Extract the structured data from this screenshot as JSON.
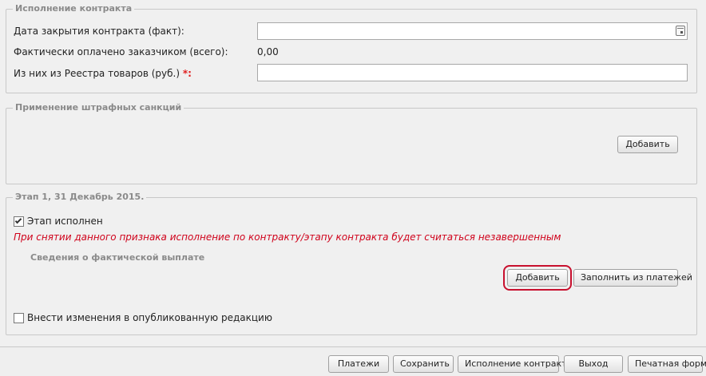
{
  "contract_execution": {
    "legend": "Исполнение контракта",
    "close_date_label": "Дата закрытия контракта (факт):",
    "close_date_value": "",
    "paid_label": "Фактически оплачено заказчиком (всего):",
    "paid_value": "0,00",
    "registry_label": "Из них из Реестра товаров (руб.)",
    "registry_required": "*:",
    "registry_value": ""
  },
  "penalties": {
    "legend": "Применение штрафных санкций",
    "add_button": "Добавить"
  },
  "stage": {
    "legend": "Этап 1, 31 Декабрь 2015.",
    "completed_label": "Этап исполнен",
    "completed_checked": true,
    "warning": "При снятии данного признака исполнение по контракту/этапу контракта будет считаться незавершенным",
    "payments_sublegend": "Сведения о фактической выплате",
    "add_button": "Добавить",
    "fill_button": "Заполнить из платежей",
    "publish_changes_label": "Внести изменения в опубликованную редакцию",
    "publish_changes_checked": false
  },
  "footer": {
    "payments_button": "Платежи",
    "save_button": "Сохранить",
    "execution_button": "Исполнение контракта",
    "exit_button": "Выход",
    "print_button": "Печатная форма"
  }
}
